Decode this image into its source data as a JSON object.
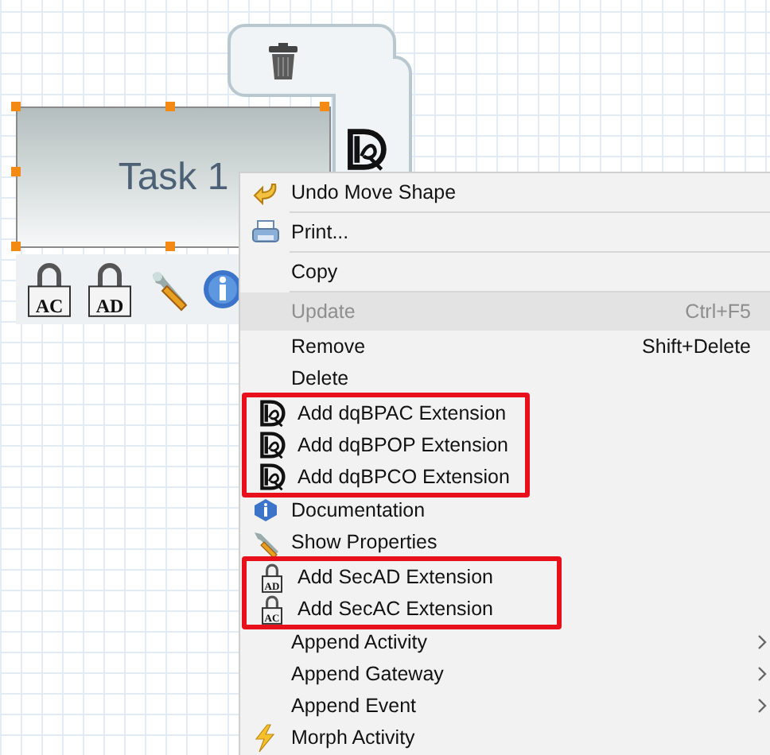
{
  "task": {
    "label": "Task 1",
    "selected": true
  },
  "task_toolbar": [
    {
      "lock_text": "AC"
    },
    {
      "lock_text": "AD"
    }
  ],
  "context_menu": {
    "entries": [
      {
        "kind": "item",
        "label": "Undo Move Shape",
        "disabled": false,
        "highlighted": false,
        "submenu": false
      },
      {
        "kind": "separator"
      },
      {
        "kind": "item",
        "label": "Print...",
        "disabled": false,
        "highlighted": false,
        "submenu": false
      },
      {
        "kind": "separator"
      },
      {
        "kind": "item",
        "label": "Copy",
        "disabled": false,
        "highlighted": false,
        "submenu": false
      },
      {
        "kind": "separator"
      },
      {
        "kind": "item",
        "label": "Update",
        "shortcut": "Ctrl+F5",
        "disabled": true,
        "highlighted": true,
        "submenu": false
      },
      {
        "kind": "item",
        "label": "Remove",
        "shortcut": "Shift+Delete",
        "disabled": false,
        "highlighted": false,
        "submenu": false
      },
      {
        "kind": "item",
        "label": "Delete",
        "disabled": false,
        "highlighted": false,
        "submenu": false
      },
      {
        "kind": "highlight",
        "items": [
          {
            "kind": "item",
            "label": "Add dqBPAC Extension",
            "disabled": false,
            "highlighted": false,
            "submenu": false
          },
          {
            "kind": "item",
            "label": "Add dqBPOP Extension",
            "disabled": false,
            "highlighted": false,
            "submenu": false
          },
          {
            "kind": "item",
            "label": "Add dqBPCO Extension",
            "disabled": false,
            "highlighted": false,
            "submenu": false
          }
        ]
      },
      {
        "kind": "item",
        "label": "Documentation",
        "disabled": false,
        "highlighted": false,
        "submenu": false
      },
      {
        "kind": "item",
        "label": "Show Properties",
        "disabled": false,
        "highlighted": false,
        "submenu": false
      },
      {
        "kind": "highlight",
        "items": [
          {
            "kind": "item",
            "label": "Add SecAD Extension",
            "lock_text": "AD",
            "disabled": false,
            "highlighted": false,
            "submenu": false
          },
          {
            "kind": "item",
            "label": "Add SecAC Extension",
            "lock_text": "AC",
            "disabled": false,
            "highlighted": false,
            "submenu": false
          }
        ]
      },
      {
        "kind": "item",
        "label": "Append Activity",
        "disabled": false,
        "highlighted": false,
        "submenu": true
      },
      {
        "kind": "item",
        "label": "Append Gateway",
        "disabled": false,
        "highlighted": false,
        "submenu": true
      },
      {
        "kind": "item",
        "label": "Append Event",
        "disabled": false,
        "highlighted": false,
        "submenu": true
      },
      {
        "kind": "item",
        "label": "Morph Activity",
        "disabled": false,
        "highlighted": false,
        "submenu": false
      }
    ]
  }
}
